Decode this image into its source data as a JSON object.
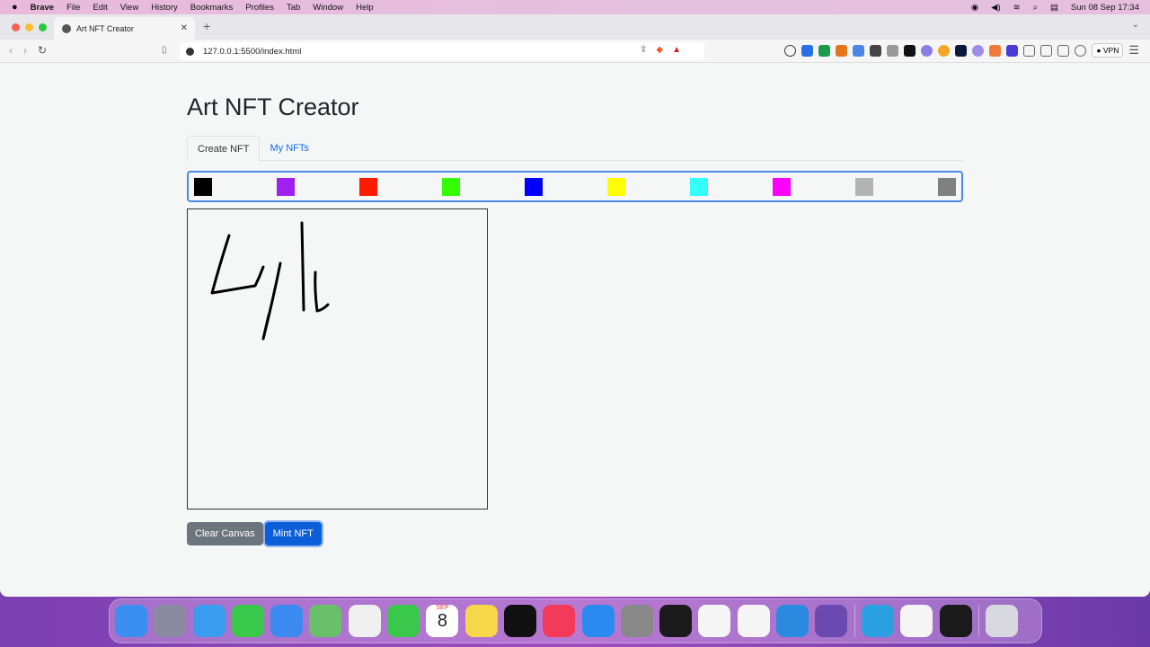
{
  "menubar": {
    "app": "Brave",
    "items": [
      "File",
      "Edit",
      "View",
      "History",
      "Bookmarks",
      "Profiles",
      "Tab",
      "Window",
      "Help"
    ],
    "datetime": "Sun 08 Sep  17:34"
  },
  "browser": {
    "tab_title": "Art NFT Creator",
    "url": "127.0.0.1:5500/index.html",
    "vpn_label": "VPN"
  },
  "page": {
    "title": "Art NFT Creator",
    "tabs": [
      {
        "label": "Create NFT",
        "active": true
      },
      {
        "label": "My NFTs",
        "active": false
      }
    ],
    "palette": [
      "#000000",
      "#a020f0",
      "#ff1a00",
      "#33ff00",
      "#0000ff",
      "#ffff00",
      "#33ffff",
      "#ff00ff",
      "#b3b3b3",
      "#808080"
    ],
    "clear_label": "Clear Canvas",
    "mint_label": "Mint NFT"
  },
  "dock": [
    "finder",
    "launchpad",
    "safari",
    "messages",
    "mail",
    "maps",
    "photos",
    "facetime",
    "calendar",
    "notes",
    "tv",
    "music",
    "app-store",
    "system-settings",
    "terminal",
    "vscode",
    "brave",
    "docker",
    "github",
    "telegram",
    "vscode",
    "activity-monitor",
    "trash"
  ],
  "calendar_icon": {
    "month": "SEP",
    "day": "8"
  }
}
